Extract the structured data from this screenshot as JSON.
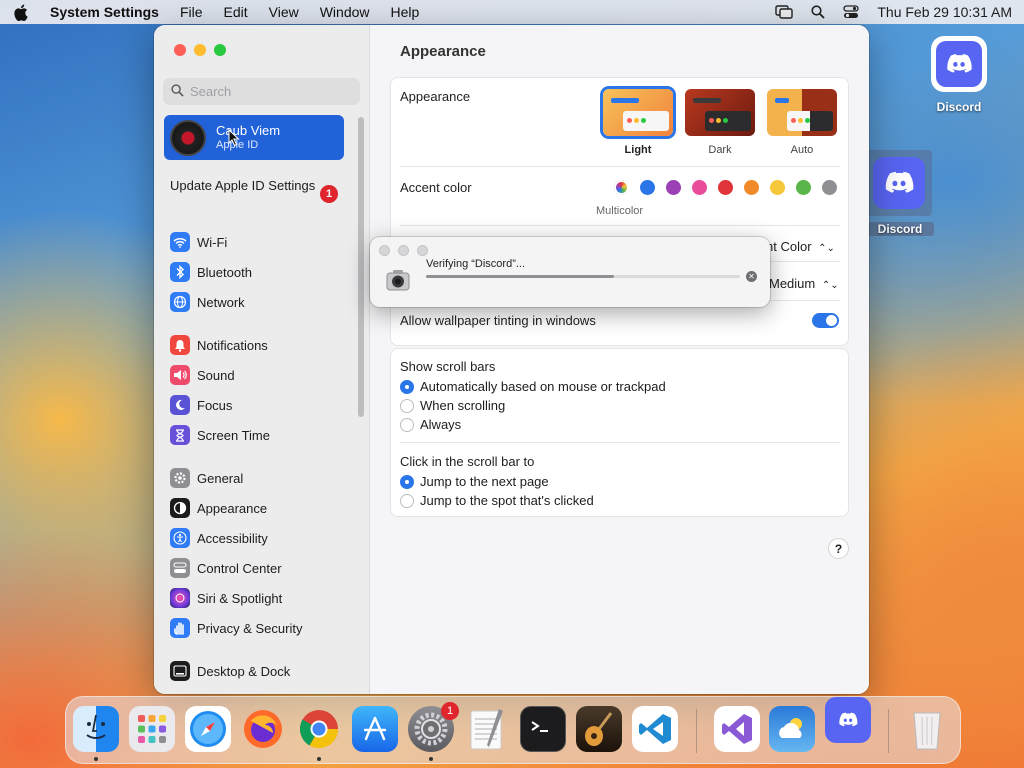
{
  "menubar": {
    "app_name": "System Settings",
    "menus": [
      "File",
      "Edit",
      "View",
      "Window",
      "Help"
    ],
    "clock": "Thu Feb 29  10:31 AM"
  },
  "sidebar": {
    "search_placeholder": "Search",
    "profile": {
      "name": "Caub Viem",
      "subtitle": "Apple ID"
    },
    "update_text": "Update Apple ID Settings",
    "update_badge": "1",
    "items": [
      {
        "label": "Wi-Fi",
        "icon": "wifi-icon",
        "color": "#2f7cf6"
      },
      {
        "label": "Bluetooth",
        "icon": "bluetooth-icon",
        "color": "#2f7cf6"
      },
      {
        "label": "Network",
        "icon": "globe-icon",
        "color": "#2f7cf6"
      },
      {
        "label": "Notifications",
        "icon": "bell-icon",
        "color": "#f0473e"
      },
      {
        "label": "Sound",
        "icon": "speaker-icon",
        "color": "#ef4b6b"
      },
      {
        "label": "Focus",
        "icon": "moon-icon",
        "color": "#5b53d6"
      },
      {
        "label": "Screen Time",
        "icon": "hourglass-icon",
        "color": "#6a4fd8"
      },
      {
        "label": "General",
        "icon": "gear-icon",
        "color": "#8e8e93"
      },
      {
        "label": "Appearance",
        "icon": "appearance-icon",
        "color": "#1c1c1e"
      },
      {
        "label": "Accessibility",
        "icon": "accessibility-icon",
        "color": "#2f7cf6"
      },
      {
        "label": "Control Center",
        "icon": "control-center-icon",
        "color": "#8e8e93"
      },
      {
        "label": "Siri & Spotlight",
        "icon": "siri-icon",
        "color": "#a94ee0"
      },
      {
        "label": "Privacy & Security",
        "icon": "hand-icon",
        "color": "#2f7cf6"
      },
      {
        "label": "Desktop & Dock",
        "icon": "dock-icon",
        "color": "#1c1c1e"
      }
    ]
  },
  "content": {
    "title": "Appearance",
    "appearance_label": "Appearance",
    "appearance_options": [
      {
        "label": "Light",
        "selected": true
      },
      {
        "label": "Dark",
        "selected": false
      },
      {
        "label": "Auto",
        "selected": false
      }
    ],
    "accent_label": "Accent color",
    "accent_caption": "Multicolor",
    "accent_colors": [
      "#b469e0",
      "#2a75e8",
      "#9b40b5",
      "#e94d9a",
      "#e0343a",
      "#f18b2a",
      "#f7c73a",
      "#5ab649",
      "#8e8e93"
    ],
    "highlight_value": "nt Color",
    "sidebar_icon_size": "Medium",
    "tinting_label": "Allow wallpaper tinting in windows",
    "tinting_on": true,
    "scroll_label": "Show scroll bars",
    "scroll_options": [
      {
        "label": "Automatically based on mouse or trackpad",
        "selected": true
      },
      {
        "label": "When scrolling",
        "selected": false
      },
      {
        "label": "Always",
        "selected": false
      }
    ],
    "click_label": "Click in the scroll bar to",
    "click_options": [
      {
        "label": "Jump to the next page",
        "selected": true
      },
      {
        "label": "Jump to the spot that's clicked",
        "selected": false
      }
    ],
    "help": "?"
  },
  "verify_dialog": {
    "text": "Verifying “Discord”...",
    "progress": 0.6
  },
  "desktop": {
    "icons": [
      {
        "label": "Discord"
      },
      {
        "label": "Discord"
      }
    ]
  },
  "dock": {
    "system_settings_badge": "1"
  }
}
